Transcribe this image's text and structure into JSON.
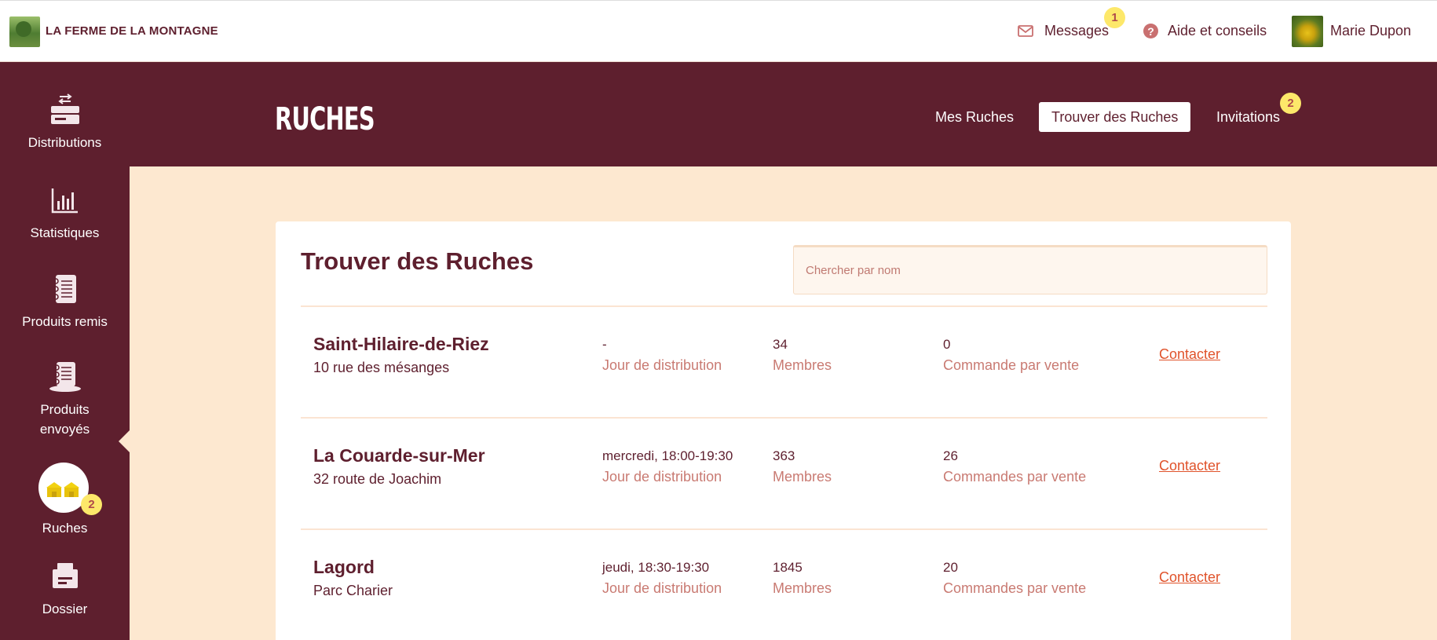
{
  "topbar": {
    "farm_name": "LA FERME DE LA MONTAGNE",
    "messages_label": "Messages",
    "messages_badge": "1",
    "help_label": "Aide et conseils",
    "user_name": "Marie Dupon"
  },
  "sidebar": {
    "items": [
      {
        "label": "Distributions",
        "icon": "distributions-icon"
      },
      {
        "label": "Statistiques",
        "icon": "chart-icon"
      },
      {
        "label": "Produits remis",
        "icon": "notebook-icon"
      },
      {
        "label": "Produits envoyés",
        "icon": "notebook-hat-icon"
      },
      {
        "label": "Ruches",
        "icon": "hive-icon",
        "badge": "2",
        "active": true
      },
      {
        "label": "Dossier",
        "icon": "folder-icon"
      }
    ]
  },
  "header": {
    "title": "RUCHES",
    "tabs": [
      {
        "label": "Mes Ruches",
        "active": false
      },
      {
        "label": "Trouver des Ruches",
        "active": true
      },
      {
        "label": "Invitations",
        "active": false,
        "badge": "2"
      }
    ]
  },
  "main": {
    "title": "Trouver des Ruches",
    "search": {
      "placeholder": "Chercher par nom",
      "value": ""
    },
    "contact_label": "Contacter",
    "rows": [
      {
        "name": "Saint-Hilaire-de-Riez",
        "address": "10 rue des mésanges",
        "day": "-",
        "day_label": "Jour de distribution",
        "members": "34",
        "members_label": "Membres",
        "orders": "0",
        "orders_label": "Commande par vente"
      },
      {
        "name": "La Couarde-sur-Mer",
        "address": "32 route de Joachim",
        "day": "mercredi, 18:00-19:30",
        "day_label": "Jour de distribution",
        "members": "363",
        "members_label": "Membres",
        "orders": "26",
        "orders_label": "Commandes par vente"
      },
      {
        "name": "Lagord",
        "address": "Parc Charier",
        "day": "jeudi, 18:30-19:30",
        "day_label": "Jour de distribution",
        "members": "1845",
        "members_label": "Membres",
        "orders": "20",
        "orders_label": "Commandes par vente"
      }
    ]
  },
  "colors": {
    "brand": "#5e1f2e",
    "background": "#fde8d0",
    "accent": "#e0532b",
    "badge": "#fde86a",
    "muted": "#c97a72"
  }
}
